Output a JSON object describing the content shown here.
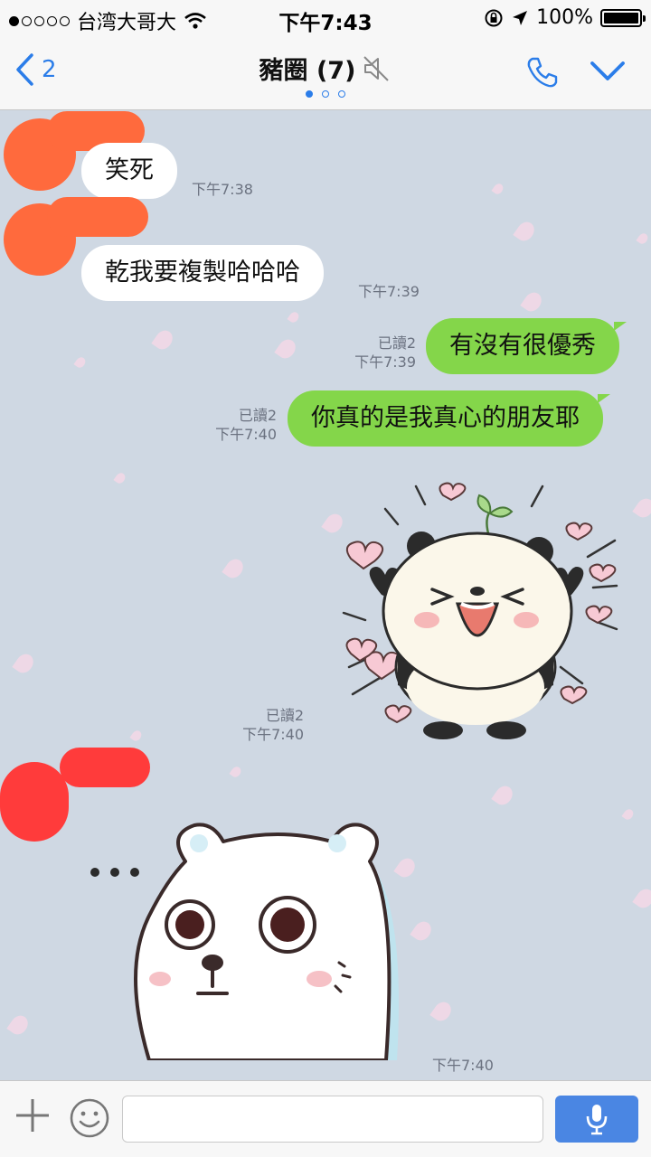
{
  "status_bar": {
    "carrier": "台湾大哥大",
    "time": "下午7:43",
    "battery": "100%",
    "signal_bars": 1
  },
  "nav": {
    "back_count": "2",
    "title": "豬圈 (7)",
    "page_count": 3,
    "active_page": 1
  },
  "colors": {
    "accent": "#2b7de9",
    "outgoing_bubble": "#84d64a",
    "incoming_bubble": "#ffffff",
    "chat_background": "#cfd8e3"
  },
  "messages": [
    {
      "direction": "in",
      "text": "笑死",
      "time": "下午7:38"
    },
    {
      "direction": "in",
      "text": "乾我要複製哈哈哈",
      "time": "下午7:39"
    },
    {
      "direction": "out",
      "text": "有沒有很優秀",
      "read": "已讀2",
      "time": "下午7:39"
    },
    {
      "direction": "out",
      "text": "你真的是我真心的朋友耶",
      "read": "已讀2",
      "time": "下午7:40"
    },
    {
      "direction": "out",
      "type": "sticker",
      "sticker": "cheering-panda",
      "read": "已讀2",
      "time": "下午7:40"
    },
    {
      "direction": "in",
      "type": "sticker",
      "sticker": "staring-white-bear",
      "time": "下午7:40"
    }
  ],
  "input": {
    "placeholder": ""
  }
}
